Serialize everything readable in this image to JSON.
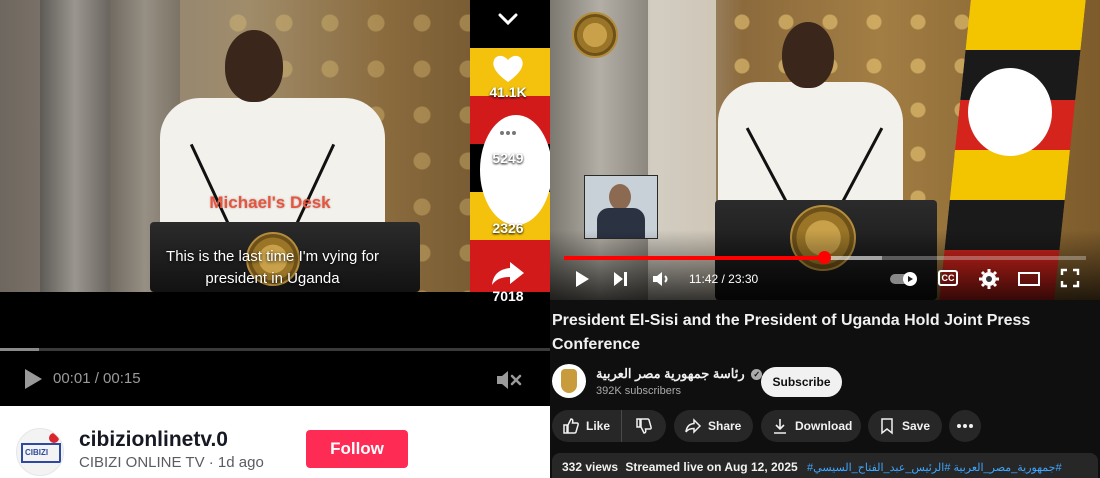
{
  "left_panel": {
    "video": {
      "watermark": "Michael's Desk",
      "caption_line1": "This is the last time I'm vying for",
      "caption_line2": "president in Uganda"
    },
    "actions": {
      "likes": "41.1K",
      "comments": "5249",
      "bookmarks": "2326",
      "shares": "7018"
    },
    "player": {
      "time": "00:01 / 00:15",
      "progress_fraction": 0.07
    },
    "profile": {
      "avatar_text": "CIBIZI",
      "handle": "cibizionlinetv.0",
      "subline": "CIBIZI ONLINE TV · 1d ago",
      "follow_label": "Follow"
    }
  },
  "right_panel": {
    "player": {
      "time": "11:42 / 23:30",
      "progress_fraction": 0.498,
      "buffered_fraction": 0.61,
      "cc_label": "CC"
    },
    "title": "President El-Sisi and the President of Uganda Hold Joint Press Conference",
    "channel": {
      "name": "رئاسة جمهورية مصر العربية",
      "subscribers": "392K subscribers",
      "subscribe_label": "Subscribe"
    },
    "actions": {
      "like_label": "Like",
      "share_label": "Share",
      "download_label": "Download",
      "save_label": "Save"
    },
    "description": {
      "views": "332 views",
      "streamed": "Streamed live on Aug 12, 2025",
      "hashtags": "#جمهورية_مصر_العربية #الرئيس_عبد_الفتاح_السيسي#"
    }
  },
  "colors": {
    "follow_red": "#fe2c55",
    "yt_red": "#ff0000",
    "watermark_orange": "#e8553f",
    "hashtag_blue": "#3ea6ff"
  }
}
